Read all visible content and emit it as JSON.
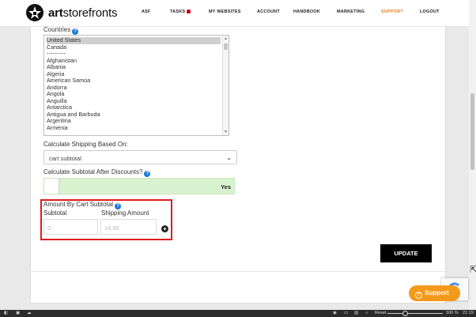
{
  "brand": {
    "bold": "art",
    "rest": "storefronts"
  },
  "nav": [
    {
      "label": "ASF"
    },
    {
      "label": "TASKS"
    },
    {
      "label": "MY WEBSITES"
    },
    {
      "label": "ACCOUNT"
    },
    {
      "label": "HANDBOOK"
    },
    {
      "label": "MARKETING"
    },
    {
      "label": "SUPPORT",
      "active": true
    },
    {
      "label": "LOGOUT"
    }
  ],
  "form": {
    "countries_label": "Countries",
    "countries": [
      "United States",
      "Canada",
      "----------",
      "Afghanistan",
      "Albania",
      "Algeria",
      "American Samoa",
      "Andorra",
      "Angola",
      "Anguilla",
      "Antarctica",
      "Antigua and Barbuda",
      "Argentina",
      "Armenia"
    ],
    "shipping_based_label": "Calculate Shipping Based On:",
    "shipping_based_value": "cart subtotal",
    "subtotal_after_label": "Calculate Subtotal After Discounts?",
    "subtotal_after_value": "Yes",
    "amount_label": "Amount By Cart Subtotal",
    "subtotal_col": "Subtotal",
    "shipping_col": "Shipping Amount",
    "subtotal_value": "0",
    "shipping_value": "14.95",
    "update_label": "UPDATE"
  },
  "support_label": "Support",
  "taskbar": {
    "reset": "Reset",
    "zoom": "100 %",
    "time": "21:19"
  },
  "colors": {
    "accent": "#e67e22",
    "highlight": "#e01b1b",
    "toggle_on": "#d8f3cf",
    "support": "#f49a1a"
  }
}
